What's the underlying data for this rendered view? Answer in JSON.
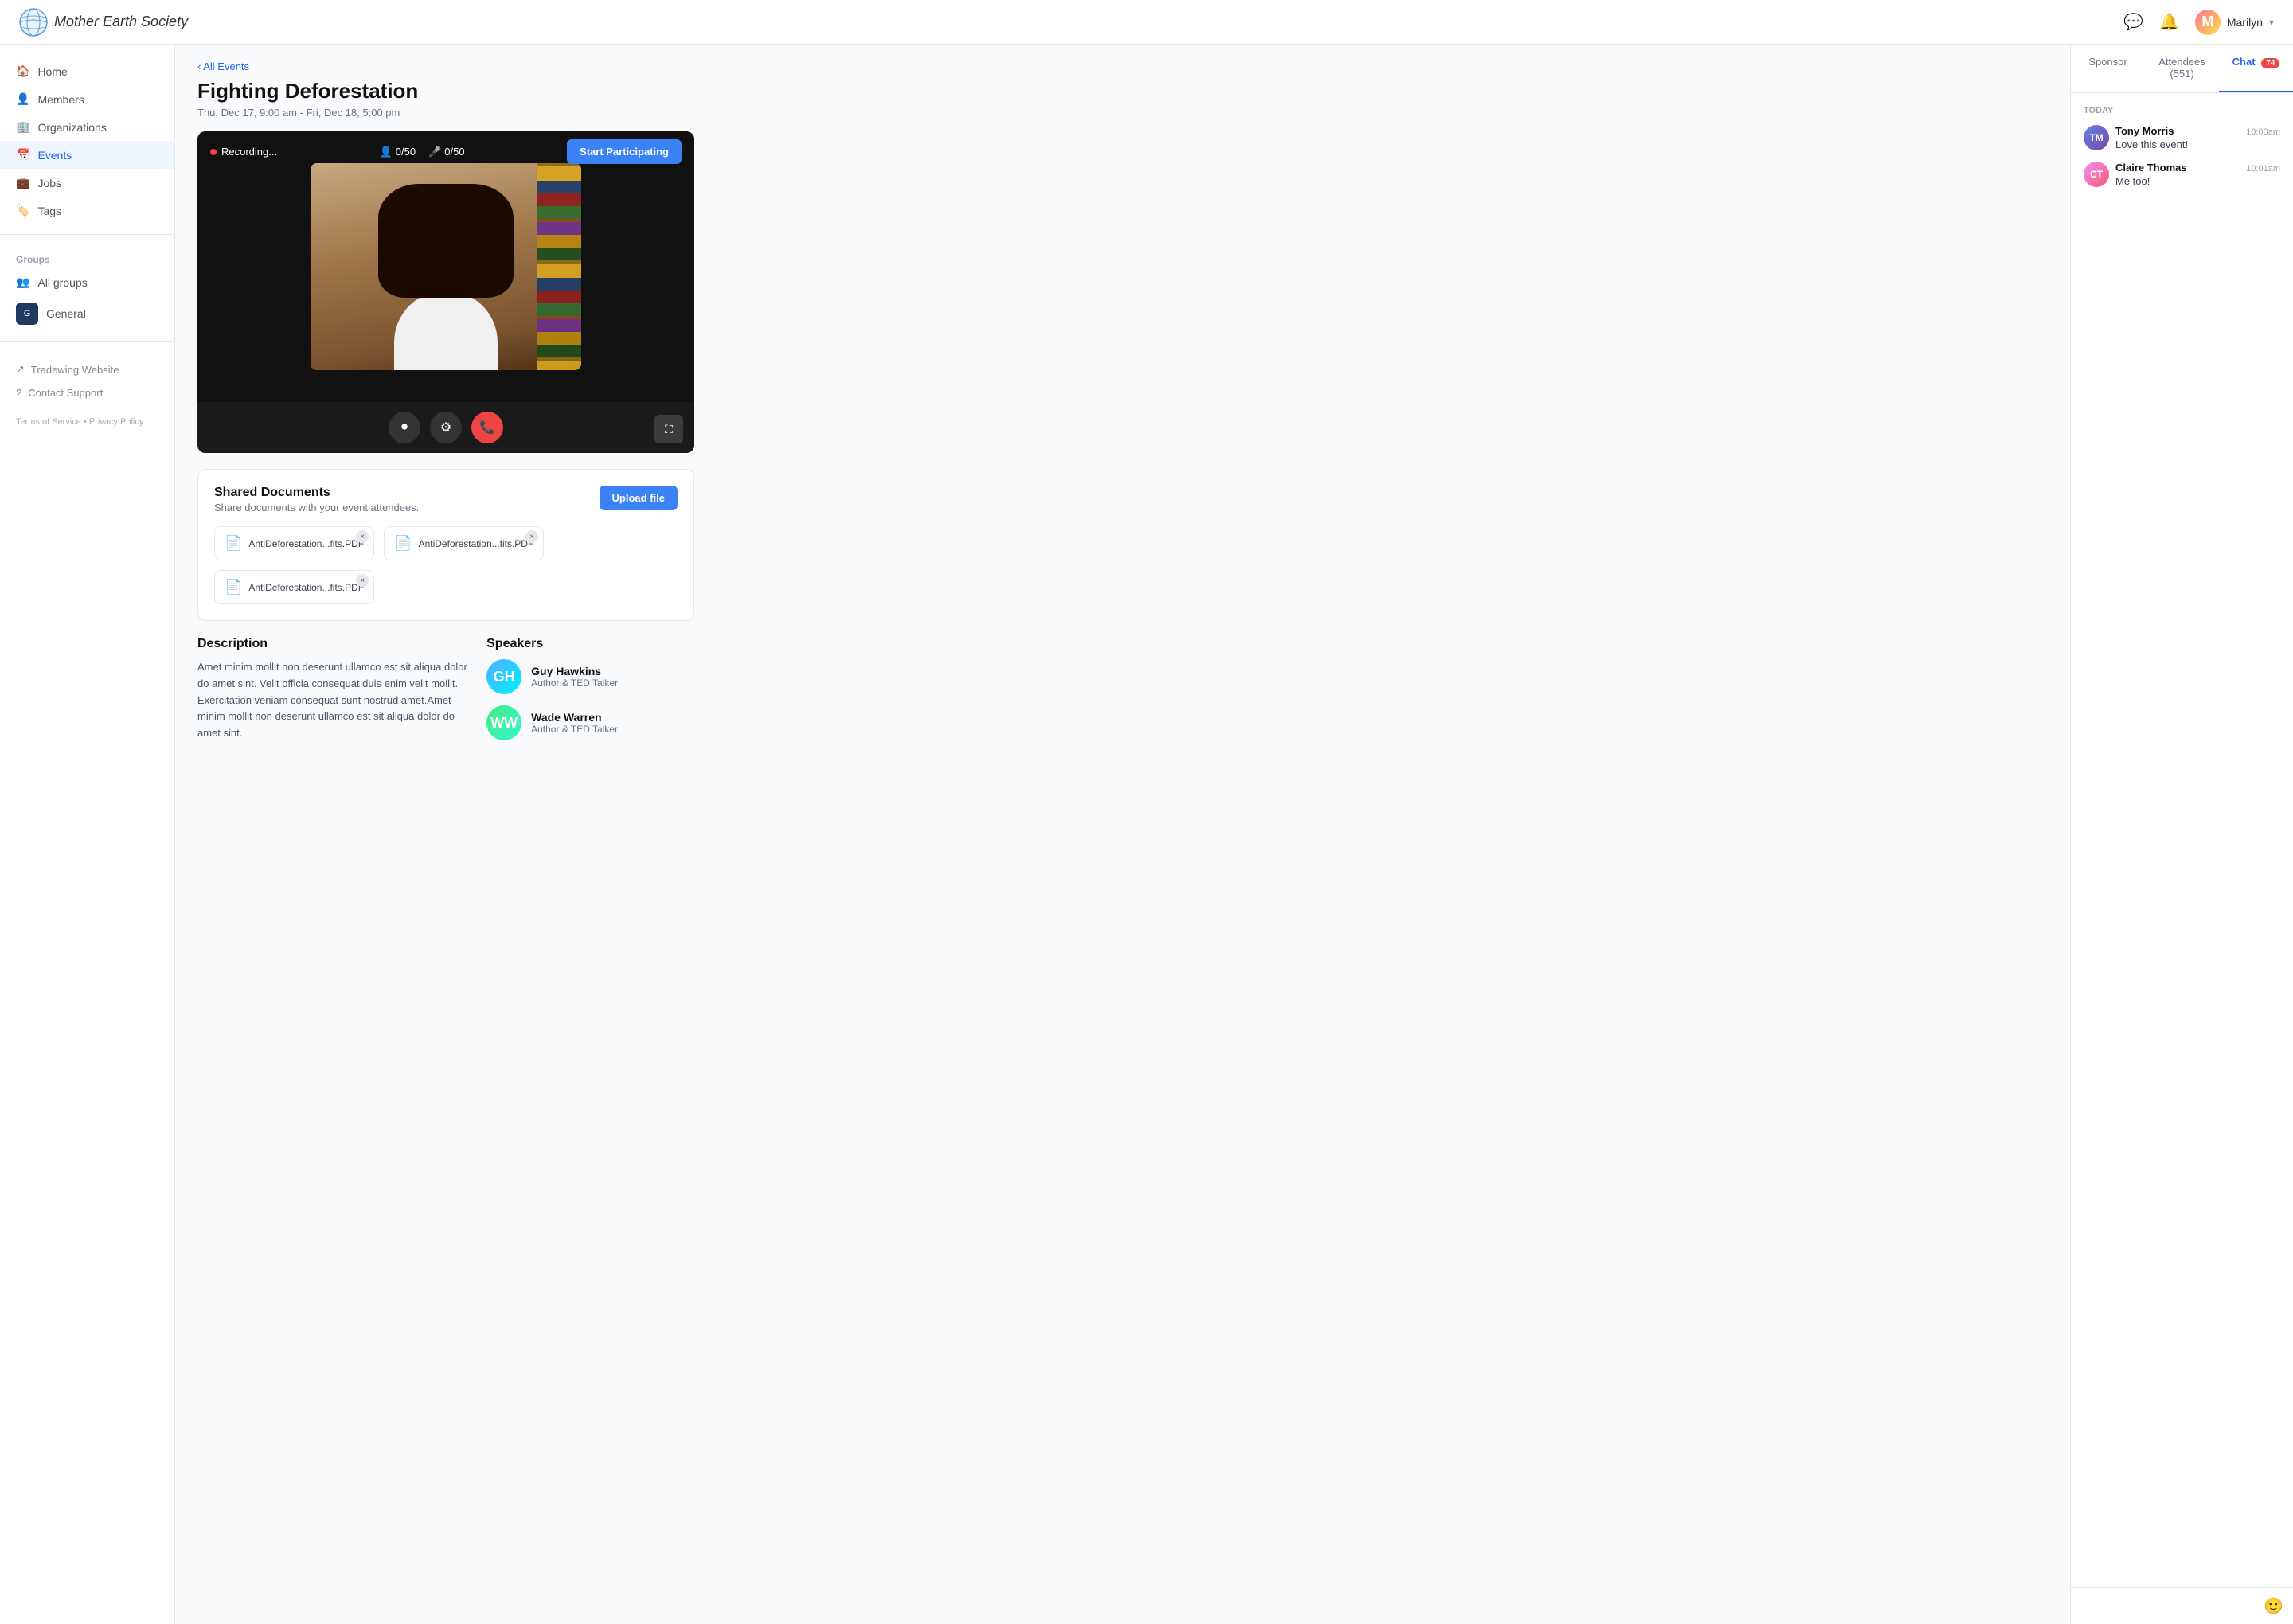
{
  "app": {
    "name": "Mother Earth Society"
  },
  "topnav": {
    "user_name": "Marilyn",
    "chat_icon": "💬",
    "bell_icon": "🔔"
  },
  "sidebar": {
    "nav_items": [
      {
        "id": "home",
        "label": "Home",
        "icon": "🏠"
      },
      {
        "id": "members",
        "label": "Members",
        "icon": "👤"
      },
      {
        "id": "organizations",
        "label": "Organizations",
        "icon": "🏢"
      },
      {
        "id": "events",
        "label": "Events",
        "icon": "📅",
        "active": true
      },
      {
        "id": "jobs",
        "label": "Jobs",
        "icon": "💼"
      },
      {
        "id": "tags",
        "label": "Tags",
        "icon": "🏷️"
      }
    ],
    "groups_label": "Groups",
    "group_items": [
      {
        "id": "all-groups",
        "label": "All groups",
        "icon": "👥"
      },
      {
        "id": "general",
        "label": "General",
        "color": "#1e3a5f"
      }
    ],
    "bottom_links": [
      {
        "id": "tradewing",
        "label": "Tradewing Website",
        "icon": "↗"
      },
      {
        "id": "support",
        "label": "Contact Support",
        "icon": "?"
      }
    ],
    "footer": "Terms of Service • Privacy Policy"
  },
  "event": {
    "breadcrumb": "All Events",
    "title": "Fighting Deforestation",
    "date": "Thu, Dec 17, 9:00 am - Fri, Dec 18, 5:00 pm",
    "recording_label": "Recording...",
    "video_count_camera": "0/50",
    "video_count_mic": "0/50",
    "start_btn": "Start Participating",
    "shared_docs_title": "Shared Documents",
    "shared_docs_sub": "Share documents with your event attendees.",
    "upload_btn": "Upload file",
    "files": [
      {
        "name": "AntiDeforestation...fits.PDF"
      },
      {
        "name": "AntiDeforestation...fits.PDF"
      },
      {
        "name": "AntiDeforestation...fits.PDF"
      }
    ],
    "description_title": "Description",
    "description_text": "Amet minim mollit non deserunt ullamco est sit aliqua dolor do amet sint. Velit officia consequat duis enim velit mollit. Exercitation veniam consequat sunt nostrud amet.Amet minim mollit non deserunt ullamco est sit aliqua dolor do amet sint.",
    "speakers_title": "Speakers",
    "speakers": [
      {
        "name": "Guy Hawkins",
        "role": "Author & TED Talker",
        "initials": "GH"
      },
      {
        "name": "Wade Warren",
        "role": "Author & TED Talker",
        "initials": "WW"
      }
    ]
  },
  "right_panel": {
    "tabs": [
      {
        "id": "sponsor",
        "label": "Sponsor",
        "active": false
      },
      {
        "id": "attendees",
        "label": "Attendees (551)",
        "active": false
      },
      {
        "id": "chat",
        "label": "Chat",
        "badge": "74",
        "active": true
      }
    ],
    "chat_day_label": "TODAY",
    "messages": [
      {
        "sender": "Tony Morris",
        "time": "10:00am",
        "text": "Love this event!",
        "initials": "TM",
        "av_class": "av-tony"
      },
      {
        "sender": "Claire Thomas",
        "time": "10:01am",
        "text": "Me too!",
        "initials": "CT",
        "av_class": "av-claire"
      }
    ]
  }
}
